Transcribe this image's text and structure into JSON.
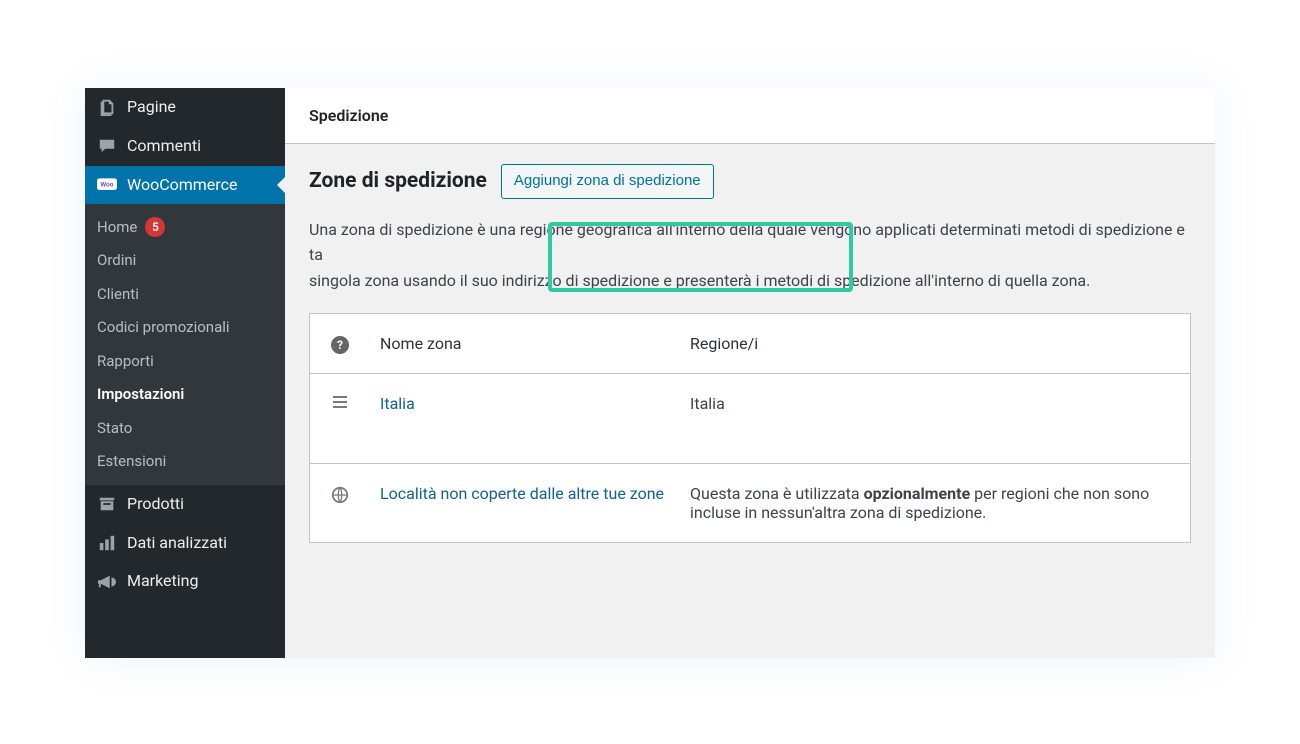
{
  "sidebar": {
    "items": [
      {
        "label": "Pagine"
      },
      {
        "label": "Commenti"
      },
      {
        "label": "WooCommerce"
      },
      {
        "label": "Prodotti"
      },
      {
        "label": "Dati analizzati"
      },
      {
        "label": "Marketing"
      }
    ],
    "submenu": [
      {
        "label": "Home",
        "badge": "5"
      },
      {
        "label": "Ordini"
      },
      {
        "label": "Clienti"
      },
      {
        "label": "Codici promozionali"
      },
      {
        "label": "Rapporti"
      },
      {
        "label": "Impostazioni",
        "current": true
      },
      {
        "label": "Stato"
      },
      {
        "label": "Estensioni"
      }
    ]
  },
  "tab": {
    "title": "Spedizione"
  },
  "heading": {
    "title": "Zone di spedizione",
    "button": "Aggiungi zona di spedizione"
  },
  "description_line1": "Una zona di spedizione è una regione geografica all'interno della quale vengono applicati determinati metodi di spedizione e ta",
  "description_line2": "singola zona usando il suo indirizzo di spedizione e presenterà i metodi di spedizione all'interno di quella zona.",
  "table": {
    "header": {
      "name": "Nome zona",
      "region": "Regione/i"
    },
    "rows": [
      {
        "name": "Italia",
        "region": "Italia"
      }
    ],
    "default_row": {
      "name": "Località non coperte dalle altre tue zone",
      "region_prefix": "Questa zona è utilizzata ",
      "region_strong": "opzionalmente",
      "region_suffix": " per regioni che non sono incluse in nessun'altra zona di spedizione."
    }
  },
  "help_glyph": "?"
}
